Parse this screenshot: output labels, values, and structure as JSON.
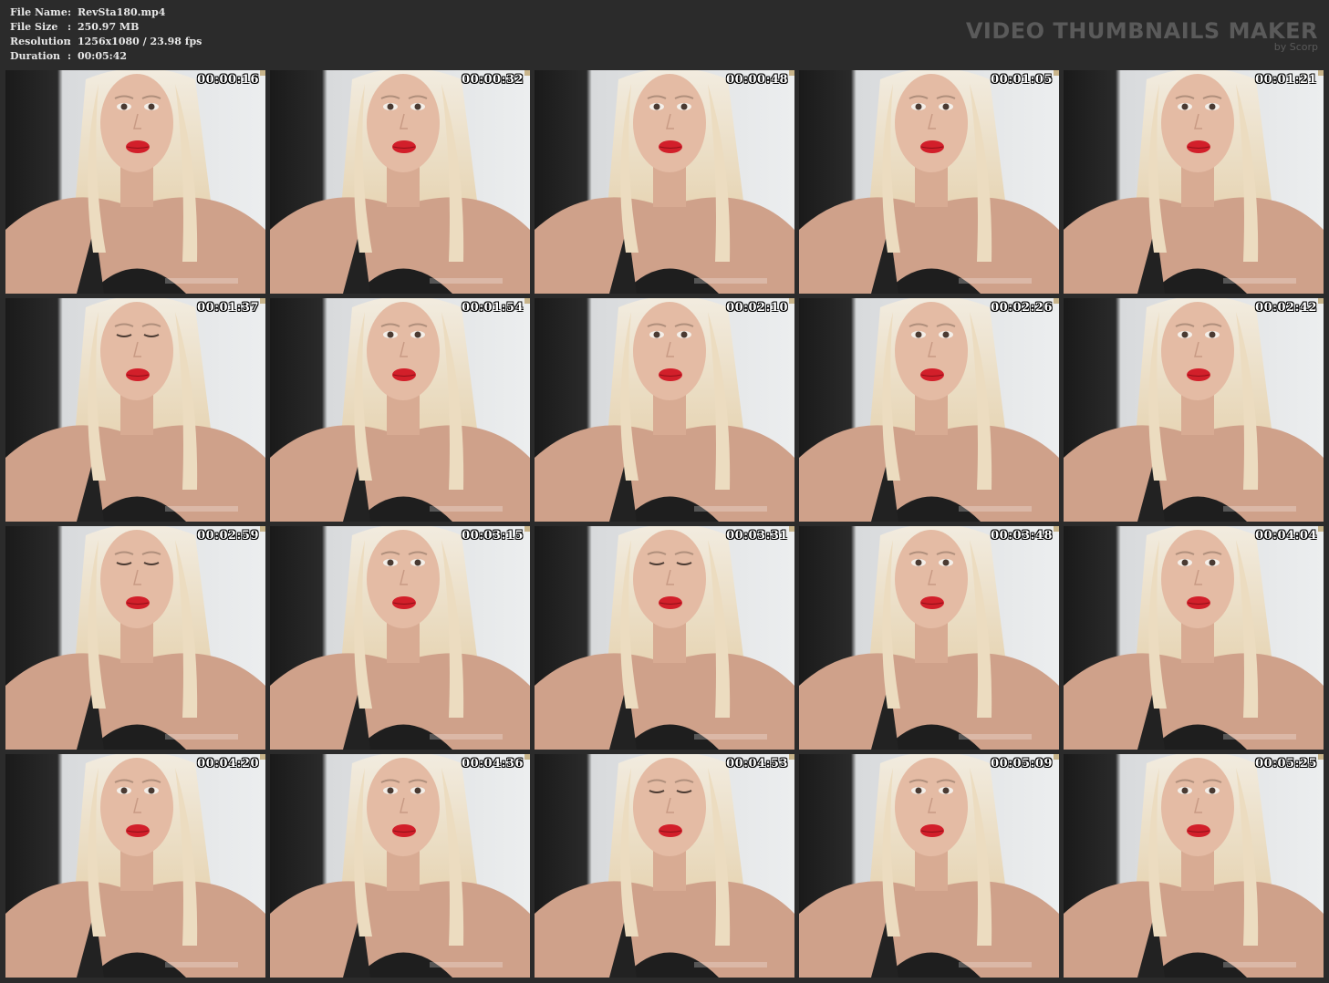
{
  "info": {
    "rows": [
      {
        "label": "File Name",
        "sep": ":",
        "value": "RevSta180.mp4"
      },
      {
        "label": "File Size",
        "sep": ":",
        "value": "250.97 MB"
      },
      {
        "label": "Resolution",
        "sep": ":",
        "value": "1256x1080 / 23.98 fps"
      },
      {
        "label": "Duration",
        "sep": ":",
        "value": "00:05:42"
      }
    ]
  },
  "brand": {
    "title": "VIDEO THUMBNAILS MAKER",
    "subtitle": "by Scorp"
  },
  "thumbnails": [
    {
      "time": "00:00:16"
    },
    {
      "time": "00:00:32"
    },
    {
      "time": "00:00:48"
    },
    {
      "time": "00:01:05"
    },
    {
      "time": "00:01:21"
    },
    {
      "time": "00:01:37"
    },
    {
      "time": "00:01:54"
    },
    {
      "time": "00:02:10"
    },
    {
      "time": "00:02:26"
    },
    {
      "time": "00:02:42"
    },
    {
      "time": "00:02:59"
    },
    {
      "time": "00:03:15"
    },
    {
      "time": "00:03:31"
    },
    {
      "time": "00:03:48"
    },
    {
      "time": "00:04:04"
    },
    {
      "time": "00:04:20"
    },
    {
      "time": "00:04:36"
    },
    {
      "time": "00:04:53"
    },
    {
      "time": "00:05:09"
    },
    {
      "time": "00:05:25"
    }
  ]
}
